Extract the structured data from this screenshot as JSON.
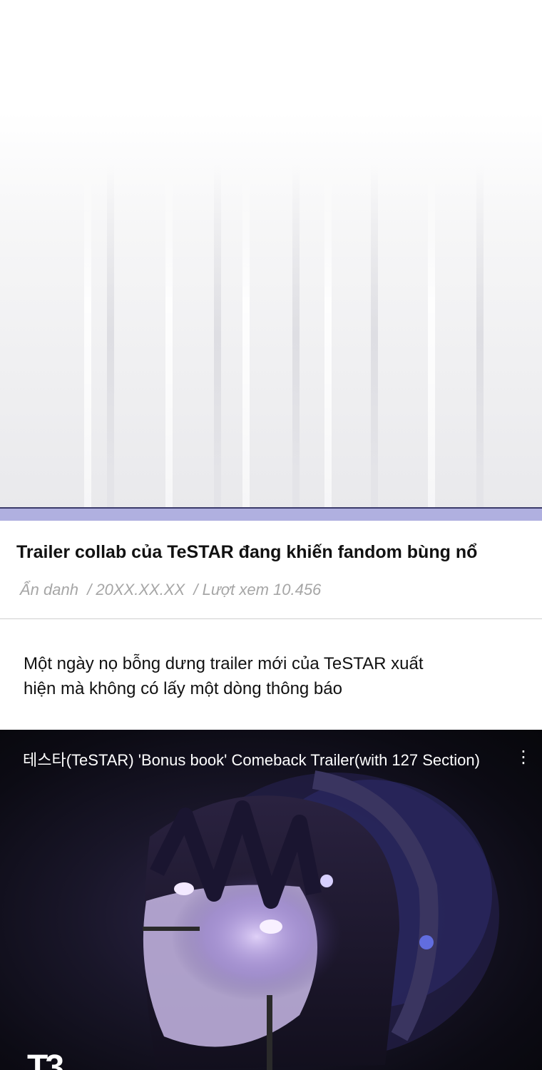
{
  "article": {
    "title": "Trailer collab của TeSTAR đang khiến fandom bùng nổ",
    "meta": {
      "author": "Ẩn danh",
      "date": "/ 20XX.XX.XX",
      "views": "/ Lượt xem 10.456"
    },
    "body_line_1": "Một ngày nọ bỗng dưng trailer mới của TeSTAR xuất",
    "body_line_2": "hiện mà không có lấy một dòng thông báo"
  },
  "video": {
    "title": "테스타(TeSTAR) 'Bonus book' Comeback Trailer(with 127 Section)",
    "more_label": "⋮",
    "channel_logo_text": "T3",
    "icon": "more-vertical-icon"
  },
  "colors": {
    "accent_bar": "#b0b0e0",
    "meta_text": "#a6a6a6",
    "video_bg": "#0c0b14"
  }
}
